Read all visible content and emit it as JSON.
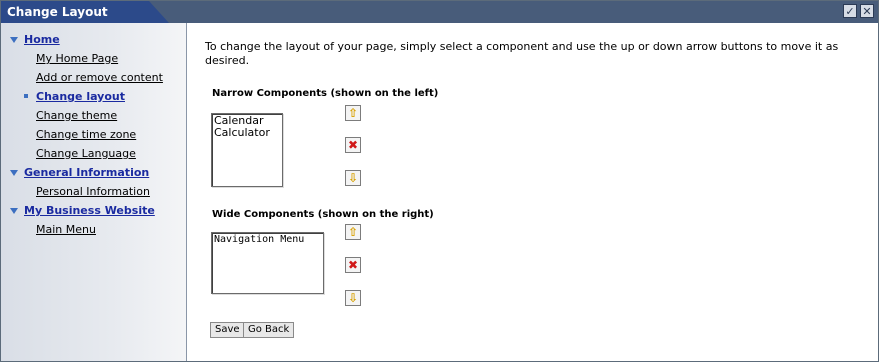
{
  "window": {
    "title": "Change Layout",
    "icons": [
      "checkmark-icon",
      "close-icon"
    ]
  },
  "sidebar": {
    "sections": [
      {
        "label": "Home",
        "items": [
          {
            "label": "My Home Page",
            "active": false
          },
          {
            "label": "Add or remove content",
            "active": false
          },
          {
            "label": "Change layout",
            "active": true
          },
          {
            "label": "Change theme",
            "active": false
          },
          {
            "label": "Change time zone",
            "active": false
          },
          {
            "label": "Change Language",
            "active": false
          }
        ]
      },
      {
        "label": "General Information",
        "items": [
          {
            "label": "Personal Information",
            "active": false
          }
        ]
      },
      {
        "label": "My Business Website",
        "items": [
          {
            "label": "Main Menu",
            "active": false
          }
        ]
      }
    ]
  },
  "main": {
    "intro": "To change the layout of your page, simply select a component and use the up or down arrow buttons to move it as desired.",
    "narrow": {
      "label": "Narrow Components (shown on the left)",
      "items": [
        "Calendar",
        "Calculator"
      ]
    },
    "wide": {
      "label": "Wide Components (shown on the right)",
      "items": [
        "Navigation Menu"
      ]
    },
    "buttons": {
      "save": "Save",
      "go_back": "Go Back"
    }
  },
  "colors": {
    "title_tab": "#2c4a8a",
    "title_bar": "#485c7a",
    "link_blue": "#1a2aa0",
    "arrow_yellow": "#d8a000",
    "delete_red": "#d01818"
  }
}
